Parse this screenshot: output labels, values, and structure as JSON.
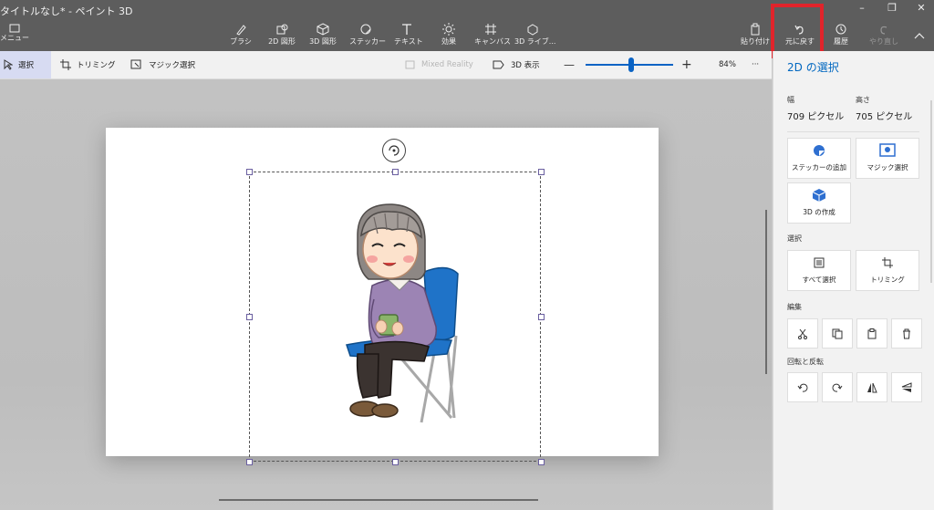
{
  "window": {
    "title": "タイトルなし* - ペイント 3D",
    "minimize": "–",
    "restore": "❐",
    "close": "✕"
  },
  "menu": {
    "label": "メニュー"
  },
  "tools": [
    {
      "label": "ブラシ",
      "icon": "brush-icon"
    },
    {
      "label": "2D 図形",
      "icon": "2d-shapes-icon"
    },
    {
      "label": "3D 図形",
      "icon": "3d-shapes-icon"
    },
    {
      "label": "ステッカー",
      "icon": "sticker-icon"
    },
    {
      "label": "テキスト",
      "icon": "text-icon"
    },
    {
      "label": "効果",
      "icon": "effects-icon"
    },
    {
      "label": "キャンバス",
      "icon": "canvas-icon"
    },
    {
      "label": "3D ライブ...",
      "icon": "3d-library-icon"
    }
  ],
  "right_tools": {
    "paste": "貼り付け",
    "undo": "元に戻す",
    "history": "履歴",
    "redo": "やり直し"
  },
  "toolbar2": {
    "select": "選択",
    "trim": "トリミング",
    "magic_select": "マジック選択",
    "mixed_reality": "Mixed Reality",
    "view3d": "3D 表示",
    "zoom_minus": "—",
    "zoom_plus": "+",
    "zoom_value": 0.52,
    "zoom_percent": "84%",
    "more": "···"
  },
  "panel": {
    "title": "2D の選択",
    "width_label": "幅",
    "width_value": "709 ピクセル",
    "height_label": "高さ",
    "height_value": "705 ピクセル",
    "add_sticker": "ステッカーの追加",
    "magic_select": "マジック選択",
    "make_3d": "3D の作成",
    "selection_section": "選択",
    "select_all": "すべて選択",
    "trim": "トリミング",
    "edit_section": "編集",
    "rotate_section": "回転と反転"
  },
  "colors": {
    "topbar": "#5d5d5d",
    "accent": "#0067c0",
    "highlight": "#e1242b",
    "chair_blue": "#1f73c8"
  }
}
